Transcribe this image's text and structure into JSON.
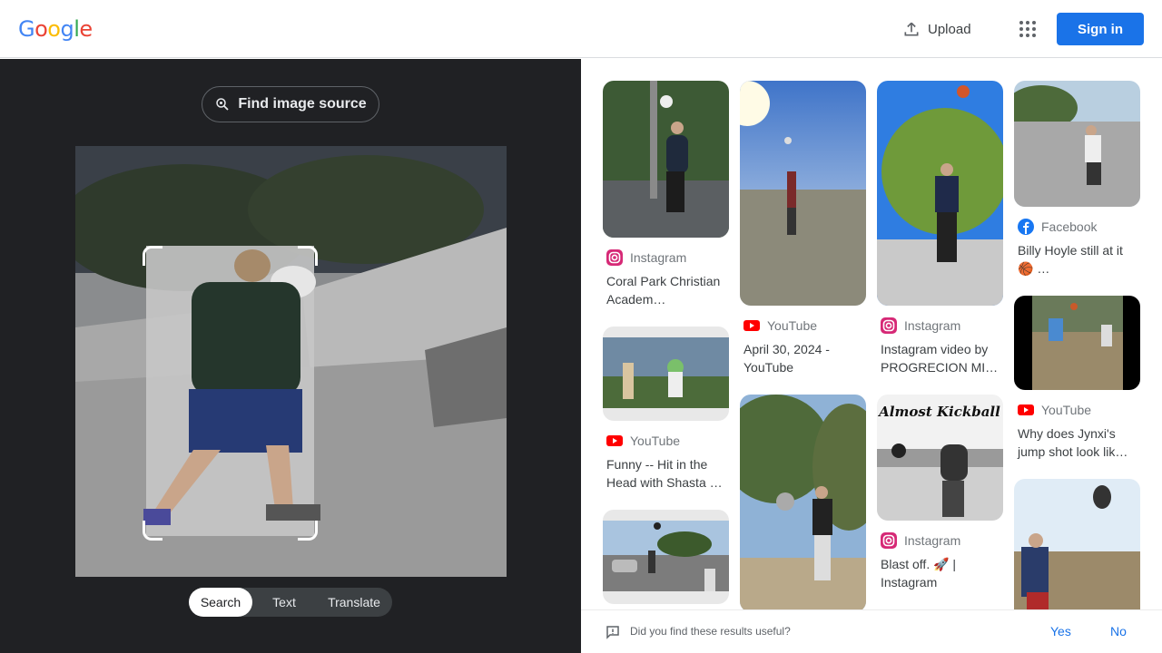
{
  "header": {
    "logo_letters": [
      "G",
      "o",
      "o",
      "g",
      "l",
      "e"
    ],
    "logo_colors": [
      "#4285F4",
      "#EA4335",
      "#FBBC05",
      "#4285F4",
      "#34A853",
      "#EA4335"
    ],
    "upload_label": "Upload",
    "signin_label": "Sign in"
  },
  "lens": {
    "find_source_label": "Find image source",
    "modes": [
      "Search",
      "Text",
      "Translate"
    ],
    "active_mode": "Search"
  },
  "results": [
    {
      "source": "Instagram",
      "icon": "instagram-icon",
      "title": "Coral Park Christian Academ…"
    },
    {
      "source": "YouTube",
      "icon": "youtube-icon",
      "title": "Funny -- Hit in the Head with Shasta …"
    },
    {
      "source": "",
      "icon": "",
      "title": ""
    },
    {
      "source": "YouTube",
      "icon": "youtube-icon",
      "title": "April 30, 2024 - YouTube"
    },
    {
      "source": "",
      "icon": "",
      "title": ""
    },
    {
      "source": "Instagram",
      "icon": "instagram-icon",
      "title": "Instagram video by PROGRECION MI…"
    },
    {
      "source": "Instagram",
      "icon": "instagram-icon",
      "title": "Blast off. 🚀 | Instagram",
      "thumb_text": "Almost Kickball"
    },
    {
      "source": "Facebook",
      "icon": "facebook-icon",
      "title": "Billy Hoyle still at it 🏀 …"
    },
    {
      "source": "YouTube",
      "icon": "youtube-icon",
      "title": "Why does Jynxi's jump shot look lik…"
    },
    {
      "source": "",
      "icon": "",
      "title": ""
    }
  ],
  "feedback": {
    "question": "Did you find these results useful?",
    "yes": "Yes",
    "no": "No"
  }
}
